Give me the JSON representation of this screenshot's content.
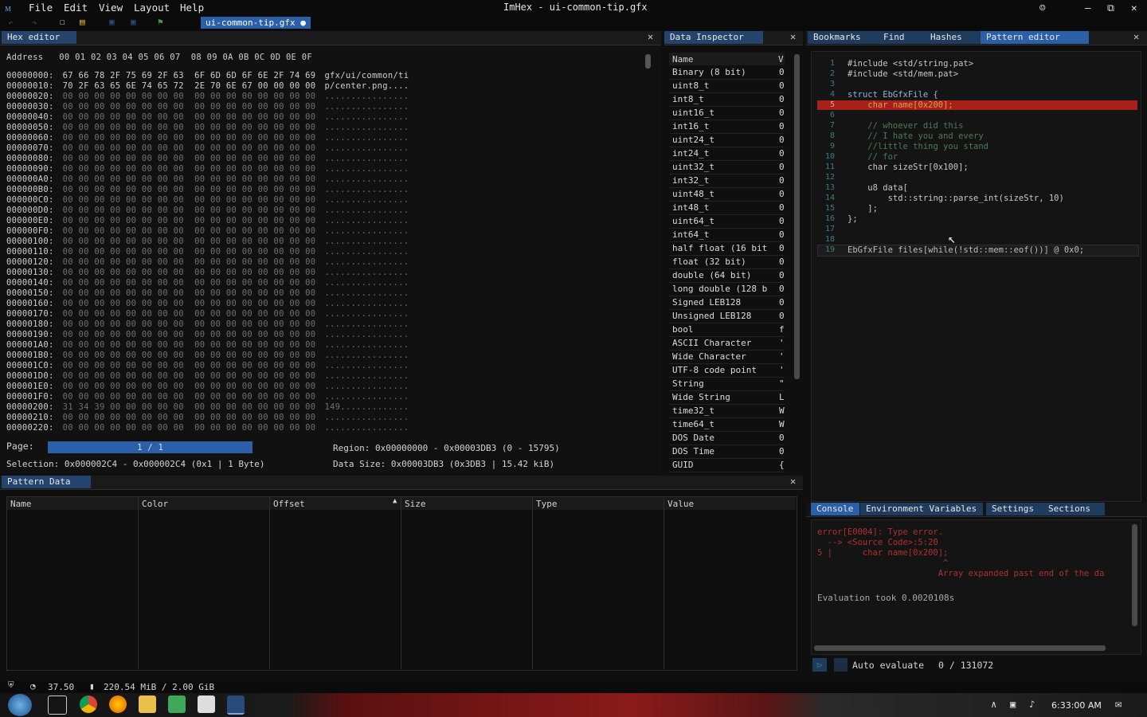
{
  "window": {
    "title": "ImHex - ui-common-tip.gfx",
    "menu": [
      "File",
      "Edit",
      "View",
      "Layout",
      "Help"
    ],
    "open_file_tab": "ui-common-tip.gfx ●"
  },
  "hex_editor": {
    "tab": "Hex editor",
    "header": "Address   00 01 02 03 04 05 06 07  08 09 0A 0B 0C 0D 0E 0F",
    "rows": [
      {
        "addr": "00000000:",
        "bytes": "67 66 78 2F 75 69 2F 63  6F 6D 6D 6F 6E 2F 74 69",
        "ascii": "gfx/ui/common/ti"
      },
      {
        "addr": "00000010:",
        "bytes": "70 2F 63 65 6E 74 65 72  2E 70 6E 67 00 00 00 00",
        "ascii": "p/center.png...."
      },
      {
        "addr": "00000020:",
        "bytes": "00 00 00 00 00 00 00 00  00 00 00 00 00 00 00 00",
        "ascii": "................"
      },
      {
        "addr": "00000030:",
        "bytes": "00 00 00 00 00 00 00 00  00 00 00 00 00 00 00 00",
        "ascii": "................"
      },
      {
        "addr": "00000040:",
        "bytes": "00 00 00 00 00 00 00 00  00 00 00 00 00 00 00 00",
        "ascii": "................"
      },
      {
        "addr": "00000050:",
        "bytes": "00 00 00 00 00 00 00 00  00 00 00 00 00 00 00 00",
        "ascii": "................"
      },
      {
        "addr": "00000060:",
        "bytes": "00 00 00 00 00 00 00 00  00 00 00 00 00 00 00 00",
        "ascii": "................"
      },
      {
        "addr": "00000070:",
        "bytes": "00 00 00 00 00 00 00 00  00 00 00 00 00 00 00 00",
        "ascii": "................"
      },
      {
        "addr": "00000080:",
        "bytes": "00 00 00 00 00 00 00 00  00 00 00 00 00 00 00 00",
        "ascii": "................"
      },
      {
        "addr": "00000090:",
        "bytes": "00 00 00 00 00 00 00 00  00 00 00 00 00 00 00 00",
        "ascii": "................"
      },
      {
        "addr": "000000A0:",
        "bytes": "00 00 00 00 00 00 00 00  00 00 00 00 00 00 00 00",
        "ascii": "................"
      },
      {
        "addr": "000000B0:",
        "bytes": "00 00 00 00 00 00 00 00  00 00 00 00 00 00 00 00",
        "ascii": "................"
      },
      {
        "addr": "000000C0:",
        "bytes": "00 00 00 00 00 00 00 00  00 00 00 00 00 00 00 00",
        "ascii": "................"
      },
      {
        "addr": "000000D0:",
        "bytes": "00 00 00 00 00 00 00 00  00 00 00 00 00 00 00 00",
        "ascii": "................"
      },
      {
        "addr": "000000E0:",
        "bytes": "00 00 00 00 00 00 00 00  00 00 00 00 00 00 00 00",
        "ascii": "................"
      },
      {
        "addr": "000000F0:",
        "bytes": "00 00 00 00 00 00 00 00  00 00 00 00 00 00 00 00",
        "ascii": "................"
      },
      {
        "addr": "00000100:",
        "bytes": "00 00 00 00 00 00 00 00  00 00 00 00 00 00 00 00",
        "ascii": "................"
      },
      {
        "addr": "00000110:",
        "bytes": "00 00 00 00 00 00 00 00  00 00 00 00 00 00 00 00",
        "ascii": "................"
      },
      {
        "addr": "00000120:",
        "bytes": "00 00 00 00 00 00 00 00  00 00 00 00 00 00 00 00",
        "ascii": "................"
      },
      {
        "addr": "00000130:",
        "bytes": "00 00 00 00 00 00 00 00  00 00 00 00 00 00 00 00",
        "ascii": "................"
      },
      {
        "addr": "00000140:",
        "bytes": "00 00 00 00 00 00 00 00  00 00 00 00 00 00 00 00",
        "ascii": "................"
      },
      {
        "addr": "00000150:",
        "bytes": "00 00 00 00 00 00 00 00  00 00 00 00 00 00 00 00",
        "ascii": "................"
      },
      {
        "addr": "00000160:",
        "bytes": "00 00 00 00 00 00 00 00  00 00 00 00 00 00 00 00",
        "ascii": "................"
      },
      {
        "addr": "00000170:",
        "bytes": "00 00 00 00 00 00 00 00  00 00 00 00 00 00 00 00",
        "ascii": "................"
      },
      {
        "addr": "00000180:",
        "bytes": "00 00 00 00 00 00 00 00  00 00 00 00 00 00 00 00",
        "ascii": "................"
      },
      {
        "addr": "00000190:",
        "bytes": "00 00 00 00 00 00 00 00  00 00 00 00 00 00 00 00",
        "ascii": "................"
      },
      {
        "addr": "000001A0:",
        "bytes": "00 00 00 00 00 00 00 00  00 00 00 00 00 00 00 00",
        "ascii": "................"
      },
      {
        "addr": "000001B0:",
        "bytes": "00 00 00 00 00 00 00 00  00 00 00 00 00 00 00 00",
        "ascii": "................"
      },
      {
        "addr": "000001C0:",
        "bytes": "00 00 00 00 00 00 00 00  00 00 00 00 00 00 00 00",
        "ascii": "................"
      },
      {
        "addr": "000001D0:",
        "bytes": "00 00 00 00 00 00 00 00  00 00 00 00 00 00 00 00",
        "ascii": "................"
      },
      {
        "addr": "000001E0:",
        "bytes": "00 00 00 00 00 00 00 00  00 00 00 00 00 00 00 00",
        "ascii": "................"
      },
      {
        "addr": "000001F0:",
        "bytes": "00 00 00 00 00 00 00 00  00 00 00 00 00 00 00 00",
        "ascii": "................"
      },
      {
        "addr": "00000200:",
        "bytes": "31 34 39 00 00 00 00 00  00 00 00 00 00 00 00 00",
        "ascii": "149............."
      },
      {
        "addr": "00000210:",
        "bytes": "00 00 00 00 00 00 00 00  00 00 00 00 00 00 00 00",
        "ascii": "................"
      },
      {
        "addr": "00000220:",
        "bytes": "00 00 00 00 00 00 00 00  00 00 00 00 00 00 00 00",
        "ascii": "................"
      }
    ],
    "page_label": "Page:",
    "page_value": "1 / 1",
    "region": "Region: 0x00000000 - 0x00003DB3 (0 - 15795)",
    "selection": "Selection: 0x000002C4 - 0x000002C4 (0x1 | 1 Byte)",
    "data_size": "Data Size: 0x00003DB3 (0x3DB3 | 15.42 kiB)"
  },
  "data_inspector": {
    "tab": "Data Inspector",
    "col_name": "Name",
    "col_value": "V",
    "rows": [
      {
        "name": "Binary (8 bit)",
        "v": "0"
      },
      {
        "name": "uint8_t",
        "v": "0"
      },
      {
        "name": "int8_t",
        "v": "0"
      },
      {
        "name": "uint16_t",
        "v": "0"
      },
      {
        "name": "int16_t",
        "v": "0"
      },
      {
        "name": "uint24_t",
        "v": "0"
      },
      {
        "name": "int24_t",
        "v": "0"
      },
      {
        "name": "uint32_t",
        "v": "0"
      },
      {
        "name": "int32_t",
        "v": "0"
      },
      {
        "name": "uint48_t",
        "v": "0"
      },
      {
        "name": "int48_t",
        "v": "0"
      },
      {
        "name": "uint64_t",
        "v": "0"
      },
      {
        "name": "int64_t",
        "v": "0"
      },
      {
        "name": "half float (16 bit",
        "v": "0"
      },
      {
        "name": "float (32 bit)",
        "v": "0"
      },
      {
        "name": "double (64 bit)",
        "v": "0"
      },
      {
        "name": "long double (128 b",
        "v": "0"
      },
      {
        "name": "Signed LEB128",
        "v": "0"
      },
      {
        "name": "Unsigned LEB128",
        "v": "0"
      },
      {
        "name": "bool",
        "v": "f"
      },
      {
        "name": "ASCII Character",
        "v": "'"
      },
      {
        "name": "Wide Character",
        "v": "'"
      },
      {
        "name": "UTF-8 code point",
        "v": "'"
      },
      {
        "name": "String",
        "v": "\""
      },
      {
        "name": "Wide String",
        "v": "L"
      },
      {
        "name": "time32_t",
        "v": "W"
      },
      {
        "name": "time64_t",
        "v": "W"
      },
      {
        "name": "DOS Date",
        "v": "0"
      },
      {
        "name": "DOS Time",
        "v": "0"
      },
      {
        "name": "GUID",
        "v": "{"
      }
    ]
  },
  "right_tabs": [
    "Bookmarks",
    "Find",
    "Hashes",
    "Pattern editor"
  ],
  "pattern_editor": {
    "lines": [
      "#include <std/string.pat>",
      "#include <std/mem.pat>",
      "",
      "struct EbGfxFile {",
      "    char name[0x200];",
      "",
      "    // whoever did this",
      "    // I hate you and every",
      "    //little thing you stand",
      "    // for",
      "    char sizeStr[0x100];",
      "",
      "    u8 data[",
      "        std::string::parse_int(sizeStr, 10)",
      "    ];",
      "};",
      "",
      "",
      "EbGfxFile files[while(!std::mem::eof())] @ 0x0;"
    ],
    "line_numbers": [
      "1",
      "2",
      "3",
      "4",
      "5",
      "6",
      "7",
      "8",
      "9",
      "10",
      "11",
      "12",
      "13",
      "14",
      "15",
      "16",
      "17",
      "18",
      "19"
    ]
  },
  "pattern_data": {
    "tab": "Pattern Data",
    "columns": [
      "Name",
      "Color",
      "Offset",
      "Size",
      "Type",
      "Value"
    ]
  },
  "console": {
    "tabs": [
      "Console",
      "Environment Variables",
      "Settings",
      "Sections"
    ],
    "error_lines": [
      "error[E0004]: Type error.",
      "  --> <Source Code>:5:20",
      "5 |      char name[0x200];",
      "                         ^",
      "                        Array expanded past end of the da"
    ],
    "eval": "Evaluation took 0.0020108s",
    "auto_evaluate": "Auto evaluate",
    "counter": "0 / 131072"
  },
  "statusbar": {
    "fps": "37.50",
    "memory": "220.54 MiB / 2.00 GiB"
  },
  "taskbar": {
    "time": "6:33:00 AM"
  },
  "colors": {
    "accent": "#2b5fa8",
    "error_line": "#a8201a",
    "error_text": "#b03030"
  }
}
